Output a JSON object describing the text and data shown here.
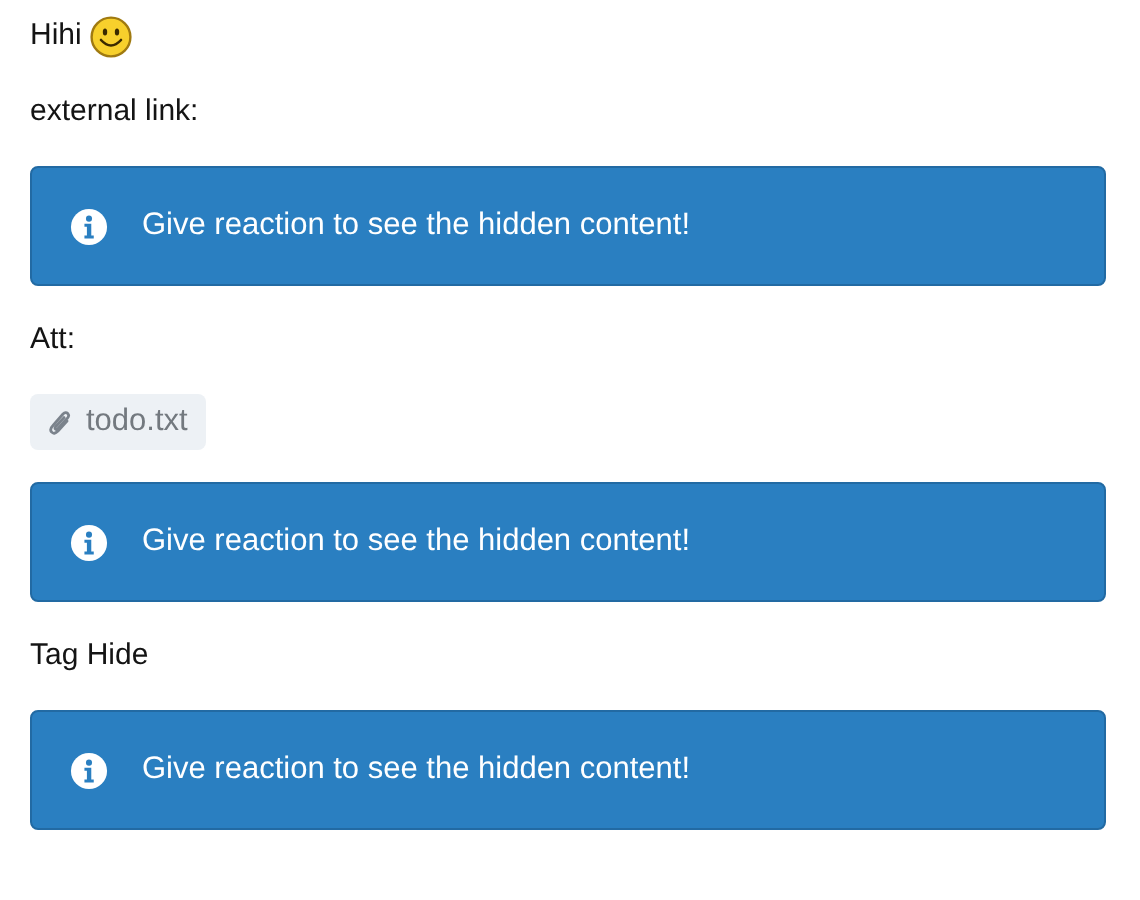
{
  "blocks": [
    {
      "kind": "smiley_text",
      "text": "Hihi"
    },
    {
      "kind": "text",
      "text": "external link:"
    },
    {
      "kind": "hidden",
      "text": "Give reaction to see the hidden content!"
    },
    {
      "kind": "text",
      "text": "Att:"
    },
    {
      "kind": "attachment",
      "text": "todo.txt"
    },
    {
      "kind": "hidden",
      "text": "Give reaction to see the hidden content!"
    },
    {
      "kind": "text",
      "text": "Tag Hide"
    },
    {
      "kind": "hidden",
      "text": "Give reaction to see the hidden content!"
    }
  ]
}
